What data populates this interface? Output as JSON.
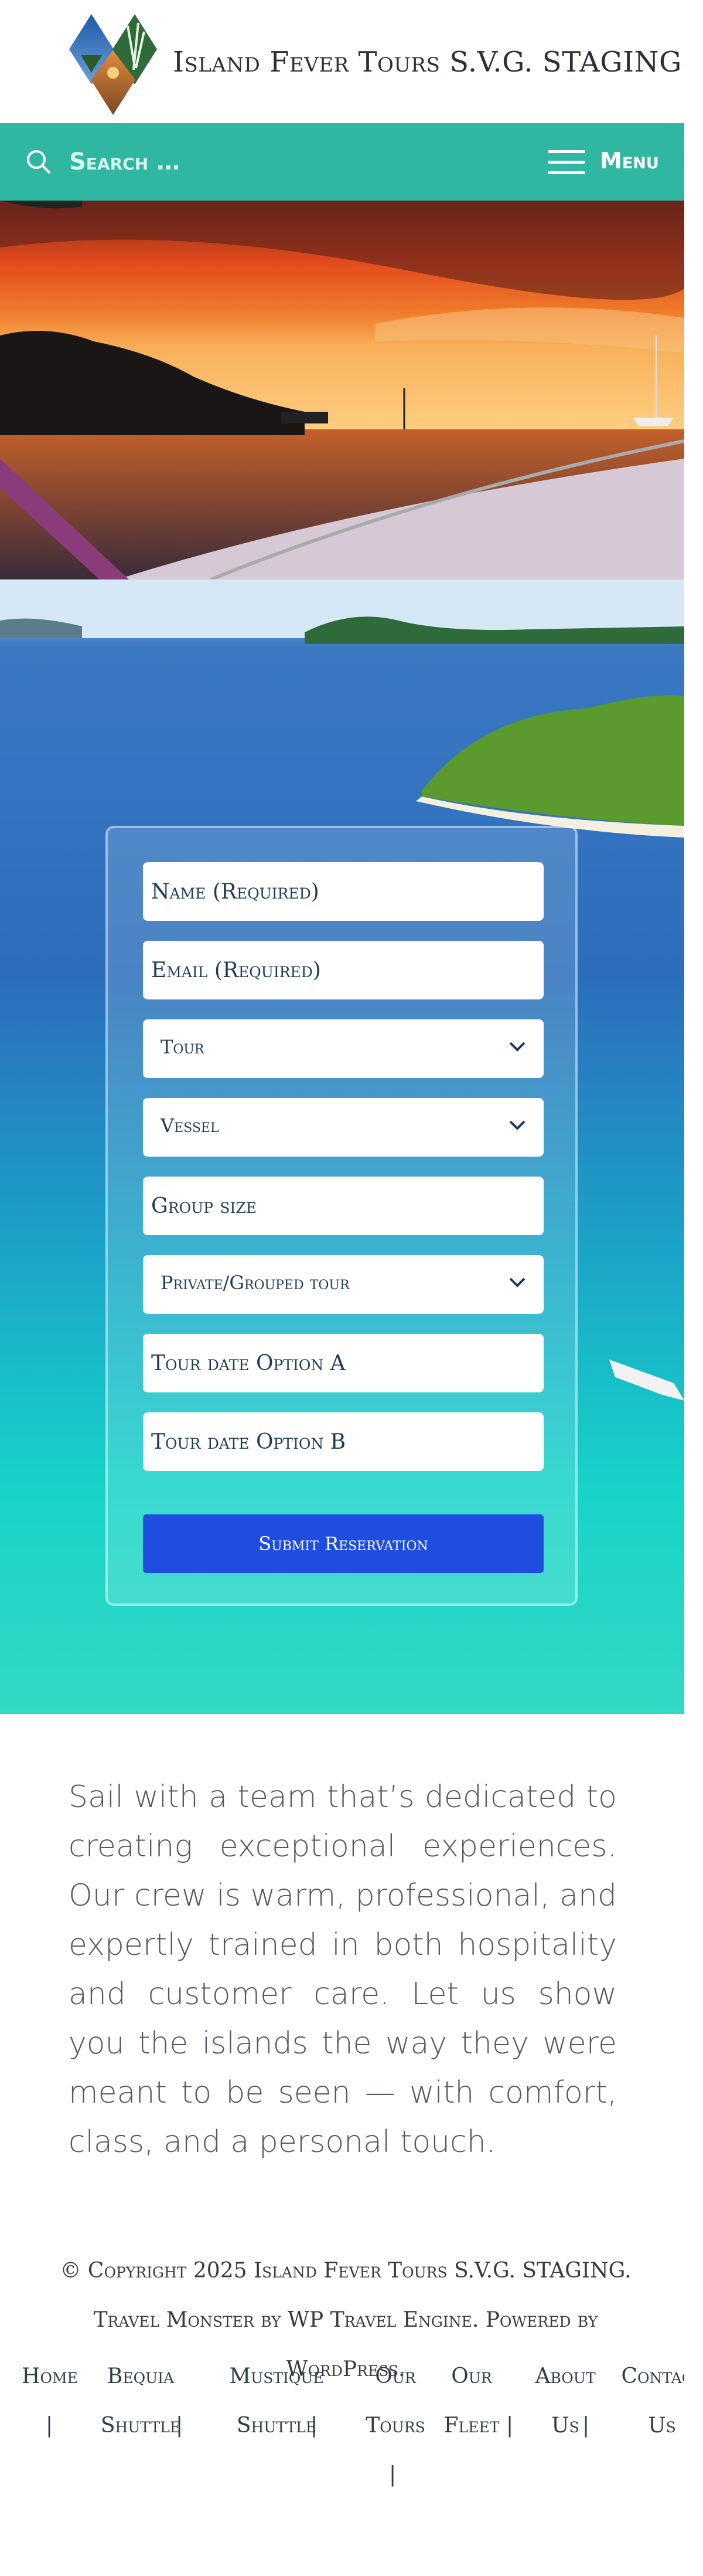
{
  "header": {
    "site_title": "Island Fever Tours S.V.G. STAGING",
    "logo_icon": "island-diamond-logo-icon"
  },
  "nav": {
    "search_placeholder": "Search …",
    "search_icon": "search-icon",
    "menu_label": "Menu",
    "menu_icon": "hamburger-icon",
    "bar_color": "#30b7a2"
  },
  "form": {
    "name_placeholder": "Name (Required)",
    "email_placeholder": "Email (Required)",
    "tour_label": "Tour",
    "vessel_label": "Vessel",
    "group_size_placeholder": "Group size",
    "private_grouped_label": "Private/Grouped tour",
    "tour_date_a_placeholder": "Tour date Option A",
    "tour_date_b_placeholder": "Tour date Option B",
    "submit_label": "Submit Reservation",
    "submit_color": "#1f4de0"
  },
  "content": {
    "intro": "Sail with a team that’s dedicated to creating exceptional experiences. Our crew is warm, professional, and expertly trained in both hospitality and customer care. Let us show you the islands the way they were meant to be seen — with comfort, class, and a personal touch."
  },
  "footer": {
    "copyright": "© Copyright 2025 Island Fever Tours S.V.G. STAGING. Travel Monster by WP Travel Engine. Powered by WordPress.",
    "menu": [
      {
        "line1": "Home",
        "line2": ""
      },
      {
        "line1": "Bequia",
        "line2": "Shuttle"
      },
      {
        "line1": "Mustique",
        "line2": "Shuttle"
      },
      {
        "line1": "Our",
        "line2": "Tours"
      },
      {
        "line1": "Our",
        "line2": "Fleet"
      },
      {
        "line1": "About",
        "line2": "Us"
      },
      {
        "line1": "Contact",
        "line2": "Us"
      }
    ],
    "separator": "|"
  }
}
